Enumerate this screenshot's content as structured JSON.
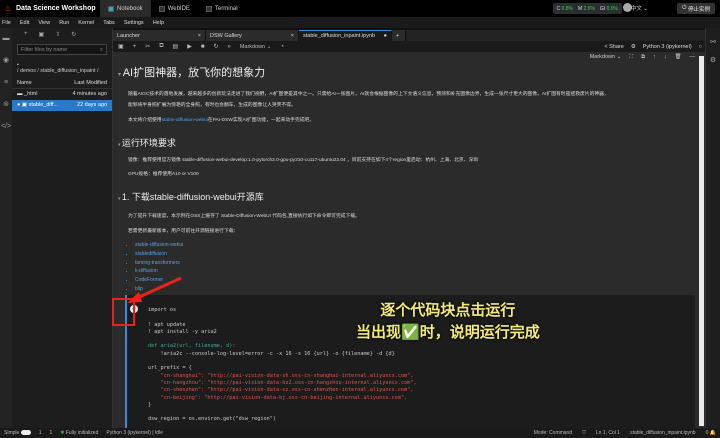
{
  "topbar": {
    "app_title": "Data Science Workshop",
    "tabs": [
      "Notebook",
      "WebIDE",
      "Terminal"
    ],
    "stats": {
      "c_label": "C",
      "c": "0.8%",
      "m_label": "M",
      "m": "2.5%",
      "g_label": "GI",
      "g": "0.0%"
    },
    "language": "中文 ⌄",
    "stop_label": "停止实例"
  },
  "menu": [
    "File",
    "Edit",
    "View",
    "Run",
    "Kernel",
    "Tabs",
    "Settings",
    "Help"
  ],
  "files": {
    "filter_placeholder": "Filter files by name",
    "breadcrumb": "/ demos / stable_diffusion_inpaint /",
    "col_name": "Name",
    "col_modified": "Last Modified",
    "rows": [
      {
        "name": "_html",
        "modified": "4 minutes ago"
      },
      {
        "name": "stable_diff...",
        "modified": "22 days ago"
      }
    ]
  },
  "tabs": [
    {
      "label": "Launcher"
    },
    {
      "label": "DSW Gallery"
    },
    {
      "label": "stable_diffusion_inpaint.ipynb"
    }
  ],
  "toolbar": {
    "cell_type": "Markdown ⌄",
    "share": "Share",
    "kernel": "Python 3 (ipykernel)"
  },
  "cell_toolbar": {
    "cell_type": "Markdown ⌄"
  },
  "notebook": {
    "h1": "AI扩图神器，放飞你的想象力",
    "p1a": "随着AIGC技术的落地发展，越来越多的创新玩法走进了我们视野，AI扩图便是其中之一。只需给AI一张图片，AI就会根据图像的上下文语义信息，预测和补充图像边界，生成一张尺寸更大的图像。AI扩图有时是拯救废片的神器，",
    "p1b": "能够将半身照扩展为惊艳的全身照，有时也会翻车，生成的图像让人哭笑不得。",
    "p2_pre": "本文将介绍使用",
    "p2_link": "stable-diffusion-webui",
    "p2_post": "在PAI-DSW实现AI扩图功能，一起来动手完成吧。",
    "h2_env": "运行环境要求",
    "env1": "镜像：推荐使用官方镜像 stable-diffusion-webui-develop:1.0-pytorch2.0-gpu-py310-cu117-ubuntu22.04 ，目前支持在如下4个region里启动：杭州、上海、北京、深圳",
    "env2": "GPU规格：推荐使用A10 or V100",
    "h2_dl": "1. 下载stable-diffusion-webui开源库",
    "dl1": "为了提升下载速度，本示例在OSS上缓存了 Stable-Diffusion-WebUI 代码包,直接执行如下命令即可完成下载。",
    "dl2": "若需更新最新版本，用户可前往开源链接进行下载：",
    "links": [
      "stable-diffusion-webui",
      "stablediffusion",
      "taming-transformers",
      "k-diffusion",
      "CodeFormer",
      "blip"
    ],
    "code": [
      "import os",
      "",
      "! apt update",
      "! apt install -y aria2",
      "",
      "def aria2(url, filename, d):",
      "    !aria2c --console-log-level=error -c -x 16 -s 16 {url} -o {filename} -d {d}",
      "",
      "url_prefix = {",
      "    \"cn-shanghai\": \"http://pai-vision-data-sh.oss-cn-shanghai-internal.aliyuncs.com\",",
      "    \"cn-hangzhou\": \"http://pai-vision-data-hz2.oss-cn-hangzhou-internal.aliyuncs.com\",",
      "    \"cn-shenzhen\": \"http://pai-vision-data-sz.oss-cn-shenzhen-internal.aliyuncs.com\",",
      "    \"cn-beijing\": \"http://pai-vision-data-bj.oss-cn-beijing-internal.aliyuncs.com\",",
      "}",
      "",
      "dsw_region = os.environ.get(\"dsw_region\")"
    ]
  },
  "annotation": {
    "line1": "逐个代码块点击运行",
    "line2_pre": "当出现",
    "line2_emoji": "✅",
    "line2_post": "时，说明运行完成"
  },
  "status": {
    "mode_label": "Simple",
    "counts1": "1",
    "counts2": "1",
    "init": "Fully initialized",
    "kernel": "Python 3 (ipykernel) | Idle",
    "mode": "Mode: Command",
    "pos": "Ln 1, Col 1",
    "file": "stable_diffusion_inpaint.ipynb",
    "notif": "0"
  },
  "colors": {
    "accent": "#2a78c8",
    "annotation_box": "#e8231a",
    "annotation_text": "#f4ea7a"
  }
}
